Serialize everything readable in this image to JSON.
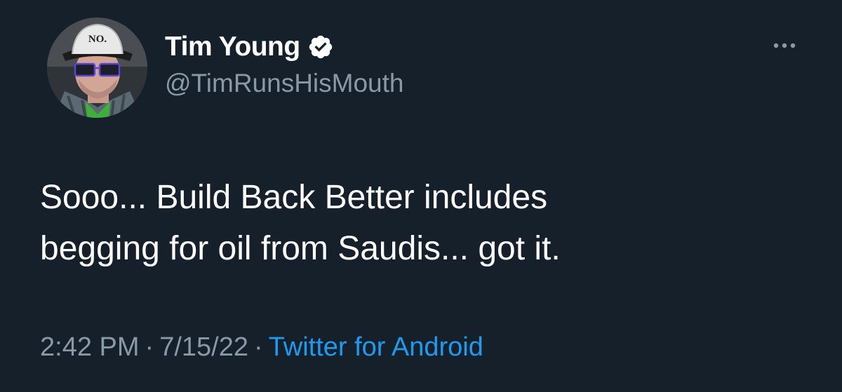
{
  "user": {
    "display_name": "Tim Young",
    "handle": "@TimRunsHisMouth",
    "hat_text": "NO."
  },
  "tweet": {
    "lines": [
      "Sooo... Build Back Better includes",
      "begging for oil from Saudis... got it."
    ]
  },
  "meta": {
    "time": "2:42 PM",
    "separator": "·",
    "date": "7/15/22",
    "source": "Twitter for Android"
  },
  "icons": {
    "verified": "verified-badge-icon",
    "more": "more-options-icon"
  },
  "colors": {
    "background": "#15202b",
    "primary_text": "#ffffff",
    "secondary_text": "#8b98a5",
    "link": "#1d9bf0"
  }
}
